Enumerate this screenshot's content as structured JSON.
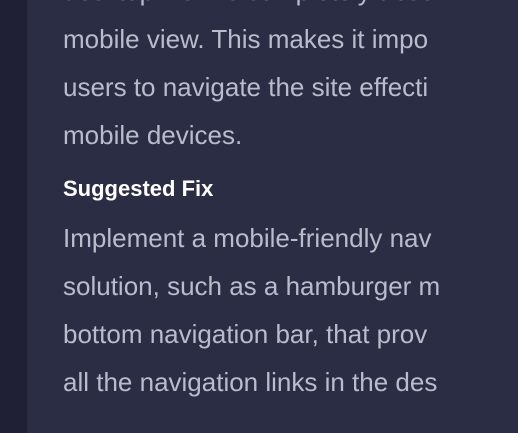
{
  "issue": {
    "description_lines": [
      "desktop view is completely abse",
      "mobile view. This makes it impo",
      "users to navigate the site effecti",
      "mobile devices."
    ],
    "suggested_fix_heading": "Suggested Fix",
    "suggested_fix_lines": [
      "Implement a mobile-friendly nav",
      "solution, such as a hamburger m",
      "bottom navigation bar, that prov",
      "all the navigation links in the des"
    ]
  }
}
